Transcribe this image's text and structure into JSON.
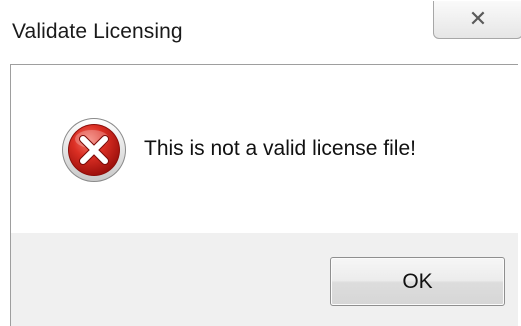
{
  "window": {
    "title": "Validate Licensing",
    "close_glyph": "✕",
    "close_icon": "close-icon"
  },
  "message": {
    "icon": "error-icon",
    "icon_color": "#c81e1e",
    "text": "This is not a valid license file!"
  },
  "buttons": {
    "ok_label": "OK"
  }
}
